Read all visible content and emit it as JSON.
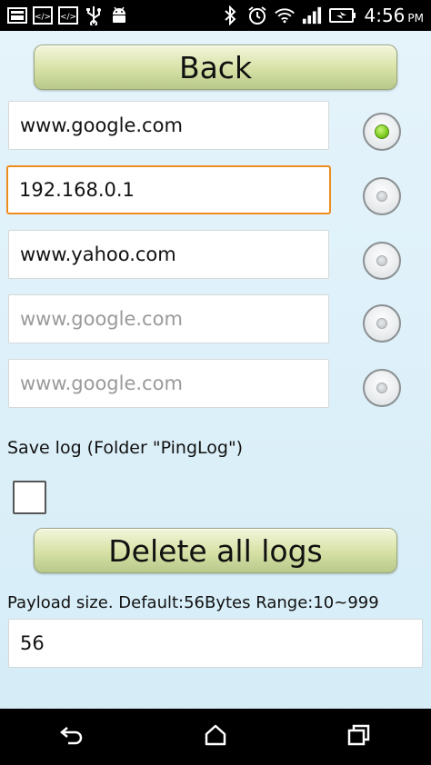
{
  "status_bar": {
    "time": "4:56",
    "ampm": "PM"
  },
  "back_button": {
    "label": "Back"
  },
  "hosts": [
    {
      "value": "www.google.com",
      "placeholder": "www.google.com",
      "selected": true,
      "focused": false
    },
    {
      "value": "192.168.0.1",
      "placeholder": "www.google.com",
      "selected": false,
      "focused": true
    },
    {
      "value": "www.yahoo.com",
      "placeholder": "www.google.com",
      "selected": false,
      "focused": false
    },
    {
      "value": "",
      "placeholder": "www.google.com",
      "selected": false,
      "focused": false
    },
    {
      "value": "",
      "placeholder": "www.google.com",
      "selected": false,
      "focused": false
    }
  ],
  "save_log": {
    "label": "Save log (Folder \"PingLog\")",
    "checked": false
  },
  "delete_button": {
    "label": "Delete all logs"
  },
  "payload": {
    "label": "Payload size. Default:56Bytes Range:10~999",
    "value": "56"
  },
  "colors": {
    "focus": "#f08c1e",
    "radio_checked": "#7ccb1e",
    "button_green": "#d9e3a9",
    "background": "#e6f4fb"
  },
  "icons": {
    "status_left": [
      "gallery-icon",
      "code-icon",
      "code-icon",
      "usb-icon",
      "android-icon"
    ],
    "status_right": [
      "bluetooth-icon",
      "alarm-icon",
      "wifi-icon",
      "signal-icon",
      "battery-charging-icon"
    ],
    "nav": [
      "back-icon",
      "home-icon",
      "recents-icon"
    ]
  }
}
